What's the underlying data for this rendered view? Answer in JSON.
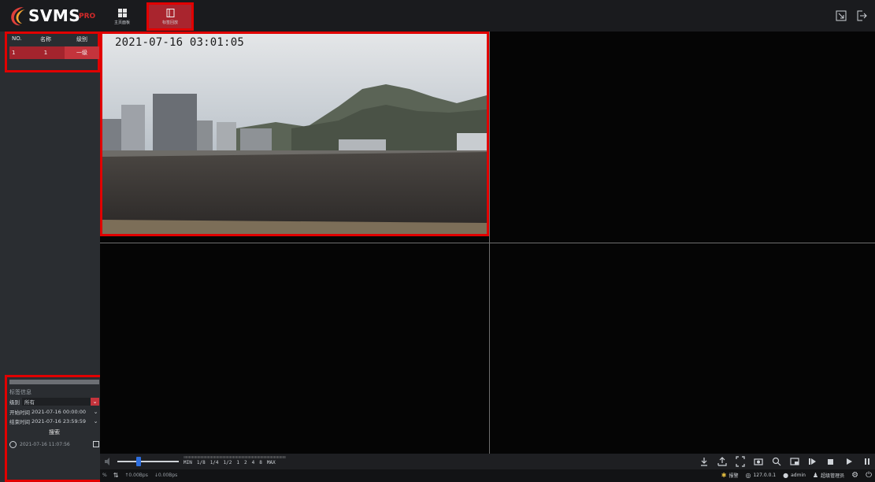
{
  "app": {
    "logo_text": "SVMS",
    "logo_suffix": "PRO"
  },
  "nav": {
    "main_label": "主页面板",
    "tag_label": "标签回放"
  },
  "list": {
    "headers": {
      "no": "NO.",
      "name": "名称",
      "level": "级别"
    },
    "rows": [
      {
        "no": "1",
        "name": "1",
        "level": "一级"
      }
    ]
  },
  "filter": {
    "title": "标签信息",
    "level_label": "级别",
    "level_value": "所有",
    "start_label": "开始时间",
    "start_value": "2021-07-16 00:00:00",
    "end_label": "结束时间",
    "end_value": "2021-07-16 23:59:59",
    "search_label": "搜索",
    "clock_time": "2021-07-16 11:07:56"
  },
  "video": {
    "timestamp": "2021-07-16 03:01:05"
  },
  "controls": {
    "speeds": [
      "MIN",
      "1/8",
      "1/4",
      "1/2",
      "1",
      "2",
      "4",
      "8",
      "MAX"
    ]
  },
  "status": {
    "percent": "%",
    "upload": "↑0.00Bps",
    "download": "↓0.00Bps",
    "alarm": "报警",
    "ip": "127.0.0.1",
    "user": "admin",
    "role": "超级管理员"
  },
  "colors": {
    "accent": "#a9252e",
    "highlight": "#e10000",
    "slider": "#2e6fe0"
  }
}
